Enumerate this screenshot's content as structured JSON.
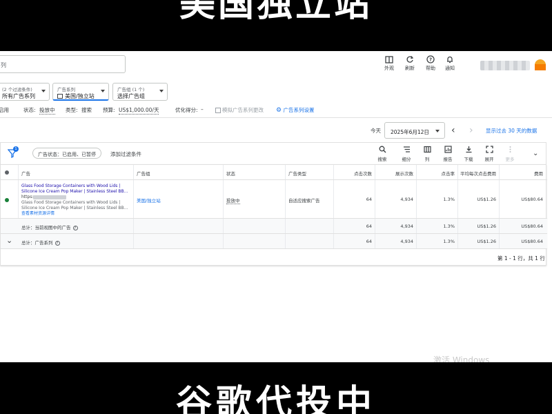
{
  "captions": {
    "top": "美国独立站",
    "bottom": "谷歌代投中"
  },
  "header": {
    "search_placeholder": "列",
    "tools": [
      {
        "icon": "appearance-icon",
        "label": "外观"
      },
      {
        "icon": "refresh-icon",
        "label": "刷新"
      },
      {
        "icon": "help-icon",
        "label": "帮助"
      },
      {
        "icon": "bell-icon",
        "label": "通知"
      }
    ]
  },
  "filters": {
    "campaign_filter": {
      "small": "(2 个过滤条件)",
      "main": "所有广告系列"
    },
    "campaign": {
      "small": "广告系列",
      "main": "美国/独立站"
    },
    "adgroup": {
      "small": "广告组 (1 个)",
      "main": "选择广告组"
    }
  },
  "status_bar": {
    "enabled": "启用",
    "status_label": "状态:",
    "status_value": "投放中",
    "type_label": "类型:",
    "type_value": "搜索",
    "budget_label": "预算:",
    "budget_value": "US$1,000.00/天",
    "score_label": "优化得分:",
    "score_value": "–",
    "simulate": "模拟广告系列更改",
    "settings": "广告系列设置"
  },
  "date": {
    "today_label": "今天",
    "selected": "2025年6月12日",
    "last30": "显示过去 30 天的数据"
  },
  "table_toolbar": {
    "filter_count": "1",
    "filter_pill": "广告状态：已启用、已暂停",
    "add_filter": "添加过滤条件",
    "tools": [
      {
        "icon": "search-icon",
        "label": "搜索",
        "enabled": true
      },
      {
        "icon": "segment-icon",
        "label": "细分",
        "enabled": true
      },
      {
        "icon": "columns-icon",
        "label": "列",
        "enabled": true
      },
      {
        "icon": "report-icon",
        "label": "报告",
        "enabled": true
      },
      {
        "icon": "download-icon",
        "label": "下载",
        "enabled": true
      },
      {
        "icon": "expand-icon",
        "label": "展开",
        "enabled": true
      },
      {
        "icon": "more-icon",
        "label": "更多",
        "enabled": false
      }
    ]
  },
  "table": {
    "columns": [
      "广告",
      "广告组",
      "状态",
      "广告类型",
      "点击次数",
      "展示次数",
      "点击率",
      "平均每次点击费用",
      "费用"
    ],
    "ad_row": {
      "ad_lines": [
        "Glass Food Storage Containers with Wood Lids |",
        "Silicone Ice Cream Pop Maker | Stainless Steel BB...",
        "Glass Food Storage Containers with Wood Lids |",
        "Silicone Ice Cream Pop Maker | Stainless Steel BB..."
      ],
      "url_prefix": "https:",
      "asset_link": "查看素材资源详情",
      "ad_group": "美国/独立站",
      "status": "投放中",
      "ad_type": "自适应搜索广告",
      "clicks": "64",
      "impressions": "4,934",
      "ctr": "1.3%",
      "avg_cpc": "US$1.26",
      "cost": "US$80.64"
    },
    "totals": [
      {
        "label": "总计：当前视图中的广告",
        "clicks": "64",
        "impressions": "4,934",
        "ctr": "1.3%",
        "avg_cpc": "US$1.26",
        "cost": "US$80.64"
      },
      {
        "label": "总计：广告系列",
        "clicks": "64",
        "impressions": "4,934",
        "ctr": "1.3%",
        "avg_cpc": "US$1.26",
        "cost": "US$80.64"
      }
    ],
    "pager": "第 1 - 1 行，共 1 行"
  },
  "watermark": "激活 Windows"
}
